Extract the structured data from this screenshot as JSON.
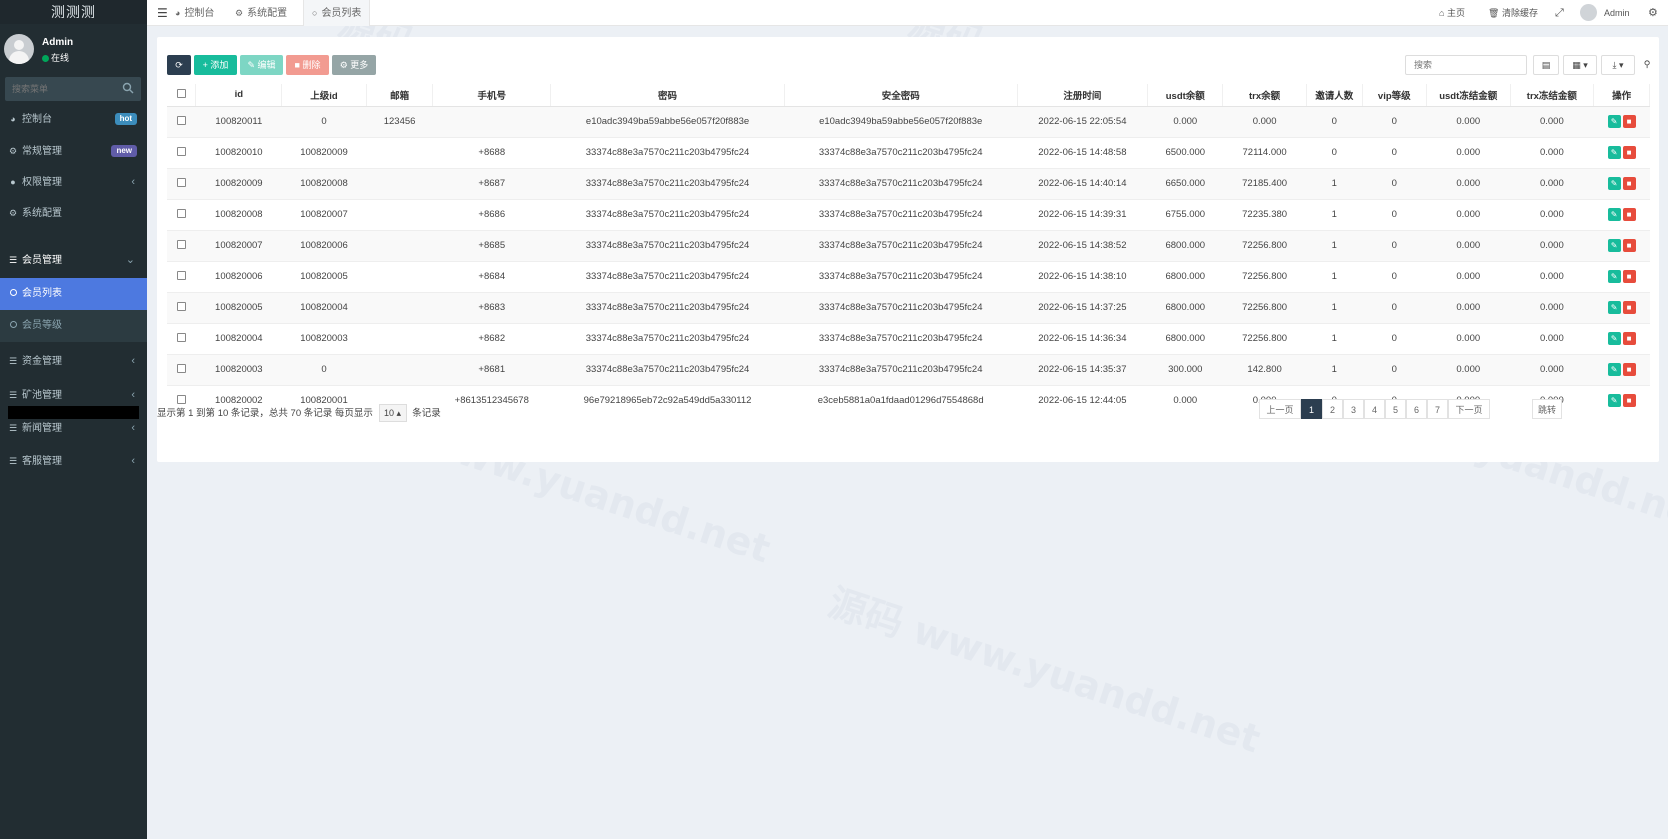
{
  "app": {
    "title": "测测测"
  },
  "user": {
    "name": "Admin",
    "status": "在线"
  },
  "sidebar": {
    "search_placeholder": "搜索菜单",
    "items": [
      {
        "label": "控制台",
        "icon": "dashboard-icon",
        "badge": "hot"
      },
      {
        "label": "常规管理",
        "icon": "cogs-icon",
        "badge": "new"
      },
      {
        "label": "权限管理",
        "icon": "users-icon"
      },
      {
        "label": "系统配置",
        "icon": "gear-icon"
      },
      {
        "label": "会员管理",
        "icon": "list-icon"
      },
      {
        "label": "资金管理",
        "icon": "list-icon"
      },
      {
        "label": "矿池管理",
        "icon": "list-icon"
      },
      {
        "label": "新闻管理",
        "icon": "list-icon"
      },
      {
        "label": "客服管理",
        "icon": "list-icon"
      }
    ],
    "submenu": [
      {
        "label": "会员列表",
        "active": true
      },
      {
        "label": "会员等级",
        "active": false
      }
    ]
  },
  "topnav": {
    "tabs": [
      {
        "label": "控制台",
        "icon": "dashboard-icon"
      },
      {
        "label": "系统配置",
        "icon": "gear-icon"
      },
      {
        "label": "会员列表",
        "icon": "circle-icon",
        "active": true
      }
    ],
    "home": "主页",
    "clear_cache": "清除缓存",
    "admin": "Admin"
  },
  "toolbar": {
    "add": "添加",
    "edit": "编辑",
    "delete": "删除",
    "more": "更多",
    "search_placeholder": "搜索"
  },
  "table": {
    "columns": [
      "id",
      "上级id",
      "邮箱",
      "手机号",
      "密码",
      "安全密码",
      "注册时间",
      "usdt余额",
      "trx余额",
      "邀请人数",
      "vip等级",
      "usdt冻结金额",
      "trx冻结金额",
      "操作"
    ],
    "rows": [
      [
        "100820011",
        "0",
        "123456",
        "",
        "e10adc3949ba59abbe56e057f20f883e",
        "e10adc3949ba59abbe56e057f20f883e",
        "2022-06-15 22:05:54",
        "0.000",
        "0.000",
        "0",
        "0",
        "0.000",
        "0.000"
      ],
      [
        "100820010",
        "100820009",
        "",
        "+8688",
        "33374c88e3a7570c211c203b4795fc24",
        "33374c88e3a7570c211c203b4795fc24",
        "2022-06-15 14:48:58",
        "6500.000",
        "72114.000",
        "0",
        "0",
        "0.000",
        "0.000"
      ],
      [
        "100820009",
        "100820008",
        "",
        "+8687",
        "33374c88e3a7570c211c203b4795fc24",
        "33374c88e3a7570c211c203b4795fc24",
        "2022-06-15 14:40:14",
        "6650.000",
        "72185.400",
        "1",
        "0",
        "0.000",
        "0.000"
      ],
      [
        "100820008",
        "100820007",
        "",
        "+8686",
        "33374c88e3a7570c211c203b4795fc24",
        "33374c88e3a7570c211c203b4795fc24",
        "2022-06-15 14:39:31",
        "6755.000",
        "72235.380",
        "1",
        "0",
        "0.000",
        "0.000"
      ],
      [
        "100820007",
        "100820006",
        "",
        "+8685",
        "33374c88e3a7570c211c203b4795fc24",
        "33374c88e3a7570c211c203b4795fc24",
        "2022-06-15 14:38:52",
        "6800.000",
        "72256.800",
        "1",
        "0",
        "0.000",
        "0.000"
      ],
      [
        "100820006",
        "100820005",
        "",
        "+8684",
        "33374c88e3a7570c211c203b4795fc24",
        "33374c88e3a7570c211c203b4795fc24",
        "2022-06-15 14:38:10",
        "6800.000",
        "72256.800",
        "1",
        "0",
        "0.000",
        "0.000"
      ],
      [
        "100820005",
        "100820004",
        "",
        "+8683",
        "33374c88e3a7570c211c203b4795fc24",
        "33374c88e3a7570c211c203b4795fc24",
        "2022-06-15 14:37:25",
        "6800.000",
        "72256.800",
        "1",
        "0",
        "0.000",
        "0.000"
      ],
      [
        "100820004",
        "100820003",
        "",
        "+8682",
        "33374c88e3a7570c211c203b4795fc24",
        "33374c88e3a7570c211c203b4795fc24",
        "2022-06-15 14:36:34",
        "6800.000",
        "72256.800",
        "1",
        "0",
        "0.000",
        "0.000"
      ],
      [
        "100820003",
        "0",
        "",
        "+8681",
        "33374c88e3a7570c211c203b4795fc24",
        "33374c88e3a7570c211c203b4795fc24",
        "2022-06-15 14:35:37",
        "300.000",
        "142.800",
        "1",
        "0",
        "0.000",
        "0.000"
      ],
      [
        "100820002",
        "100820001",
        "",
        "+8613512345678",
        "96e79218965eb72c92a549dd5a330112",
        "e3ceb5881a0a1fdaad01296d7554868d",
        "2022-06-15 12:44:05",
        "0.000",
        "0.000",
        "0",
        "0",
        "0.000",
        "0.000"
      ]
    ]
  },
  "footer": {
    "info_prefix": "显示第 1 到第 10 条记录，总共 70 条记录 每页显示",
    "page_size": "10",
    "info_suffix": "条记录"
  },
  "pagination": {
    "prev": "上一页",
    "pages": [
      "1",
      "2",
      "3",
      "4",
      "5",
      "6",
      "7"
    ],
    "current": "1",
    "next": "下一页",
    "jump": "跳转"
  },
  "watermark": {
    "text": "源码 www.yuandd.net"
  },
  "colors": {
    "sidebar": "#222d32",
    "accent": "#4d79e0",
    "success": "#18bc9c",
    "danger": "#e74c3c",
    "primary_dark": "#2c3e50"
  }
}
